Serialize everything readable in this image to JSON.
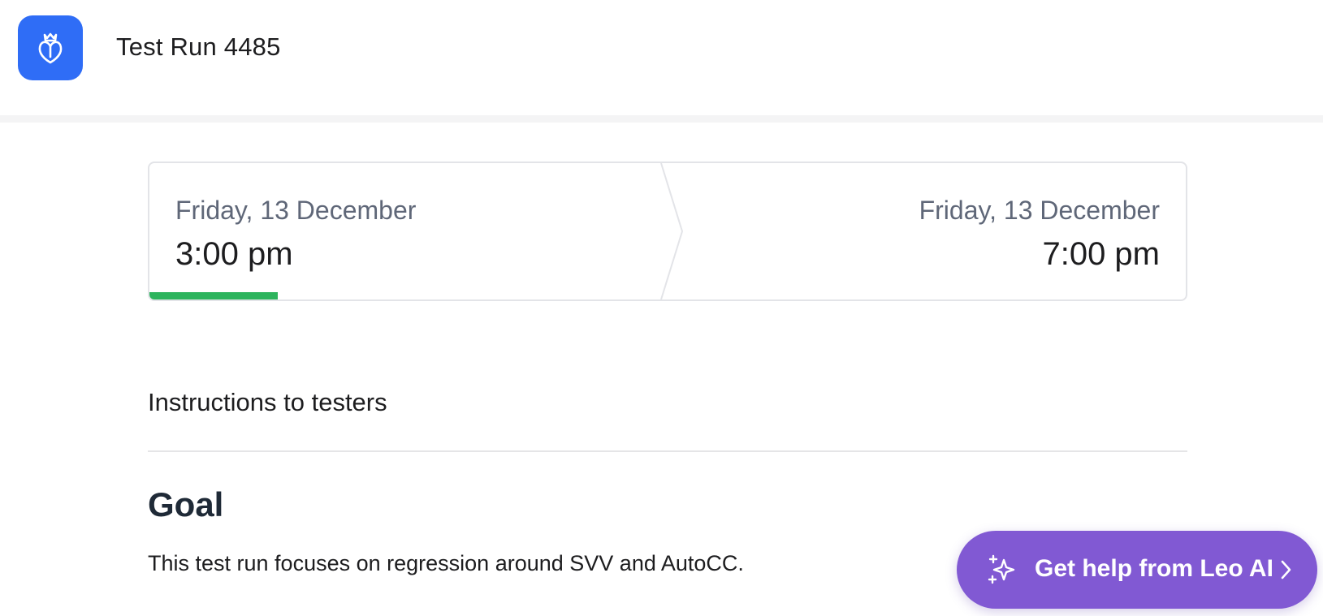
{
  "header": {
    "title": "Test Run 4485",
    "logo_icon": "crown-shield-icon",
    "brand_color": "#2f6df6"
  },
  "schedule": {
    "start": {
      "date": "Friday, 13 December",
      "time": "3:00 pm"
    },
    "end": {
      "date": "Friday, 13 December",
      "time": "7:00 pm"
    },
    "progress_fraction": 0.25,
    "progress_color": "#2db45d"
  },
  "instructions": {
    "heading": "Instructions to testers",
    "goal_heading": "Goal",
    "goal_text": "This test run focuses on regression around SVV and AutoCC."
  },
  "assistant": {
    "label": "Get help from Leo AI",
    "icon": "sparkles-icon",
    "chevron_icon": "chevron-right-icon",
    "color": "#8159d3"
  }
}
